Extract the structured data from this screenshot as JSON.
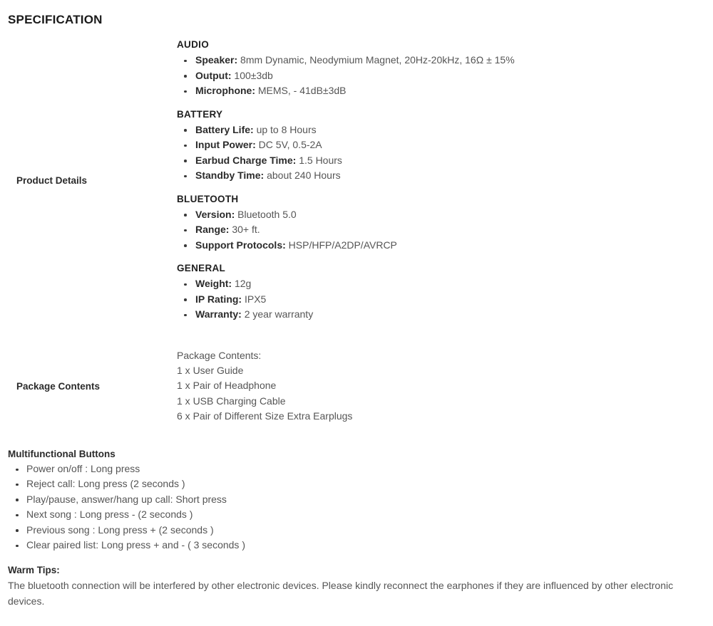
{
  "page": {
    "title": "SPECIFICATION"
  },
  "spec_rows": [
    {
      "label": "Product Details",
      "groups": [
        {
          "heading": "AUDIO",
          "items": [
            {
              "key": "Speaker:",
              "value": "8mm Dynamic, Neodymium Magnet, 20Hz-20kHz, 16Ω ± 15%"
            },
            {
              "key": "Output:",
              "value": "100±3db"
            },
            {
              "key": "Microphone:",
              "value": "MEMS, - 41dB±3dB"
            }
          ]
        },
        {
          "heading": "BATTERY",
          "items": [
            {
              "key": "Battery Life:",
              "value": "up to 8 Hours"
            },
            {
              "key": "Input Power:",
              "value": "DC 5V, 0.5-2A"
            },
            {
              "key": "Earbud Charge Time:",
              "value": "1.5 Hours"
            },
            {
              "key": "Standby Time:",
              "value": "about 240 Hours"
            }
          ]
        },
        {
          "heading": "BLUETOOTH",
          "items": [
            {
              "key": "Version:",
              "value": "Bluetooth 5.0"
            },
            {
              "key": "Range:",
              "value": "30+ ft."
            },
            {
              "key": "Support Protocols:",
              "value": "HSP/HFP/A2DP/AVRCP"
            }
          ]
        },
        {
          "heading": "GENERAL",
          "items": [
            {
              "key": "Weight:",
              "value": "12g"
            },
            {
              "key": "IP Rating:",
              "value": "IPX5"
            },
            {
              "key": "Warranty:",
              "value": "2 year warranty"
            }
          ]
        }
      ]
    }
  ],
  "package_contents": {
    "label": "Package Contents",
    "lines": [
      "Package Contents:",
      "1 x User Guide",
      "1 x Pair of Headphone",
      "1 x USB Charging Cable",
      "6 x Pair of Different Size Extra Earplugs"
    ]
  },
  "multifunctional_buttons": {
    "heading": "Multifunctional Buttons",
    "items": [
      "Power on/off : Long press",
      "Reject call: Long press (2 seconds )",
      "Play/pause, answer/hang up call: Short press",
      "Next song : Long press - (2 seconds )",
      "Previous song : Long press + (2 seconds )",
      "Clear paired list: Long press + and - ( 3 seconds )"
    ]
  },
  "warm_tips": {
    "heading": "Warm Tips:",
    "body": "The bluetooth connection will be interfered by other electronic devices. Please kindly reconnect the earphones if they are influenced by other electronic devices."
  },
  "colors": {
    "heading": "#1f1f1f",
    "body": "#555555",
    "label": "#2b2b2b",
    "background": "#ffffff"
  }
}
